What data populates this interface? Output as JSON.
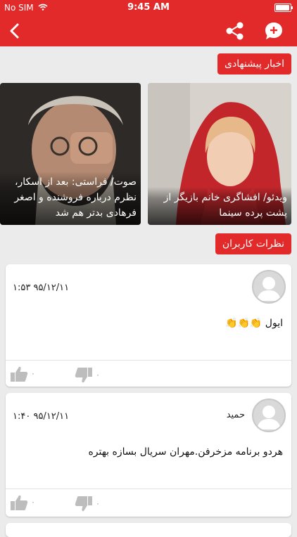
{
  "status_bar": {
    "carrier": "No SIM",
    "time": "9:45 AM",
    "battery_level": 1.0
  },
  "nav": {
    "back_icon": "chevron-left-icon",
    "share_icon": "share-icon",
    "comment_icon": "add-comment-icon"
  },
  "suggested": {
    "title": "اخبار پیشنهادی",
    "items": [
      {
        "caption": "ویدئو/ افشاگری خانم بازیگر از پشت پرده سینما"
      },
      {
        "caption": "صوت/ فراستی: بعد از اسکار، نظرم درباره فروشنده و اصغر فرهادی بدتر هم شد"
      }
    ]
  },
  "comments": {
    "title": "نظرات کاربران",
    "items": [
      {
        "name": "",
        "time": "۹۵/۱۲/۱۱ ۱:۵۳",
        "text": "ایول 👏👏👏",
        "likes": "۰",
        "dislikes": "۰"
      },
      {
        "name": "حمید",
        "time": "۹۵/۱۲/۱۱ ۱:۴۰",
        "text": "هردو برنامه مزخرفن.مهران سریال بسازه بهتره",
        "likes": "۰",
        "dislikes": "۰"
      }
    ]
  },
  "colors": {
    "accent": "#e32a2a",
    "background": "#ebebeb"
  }
}
